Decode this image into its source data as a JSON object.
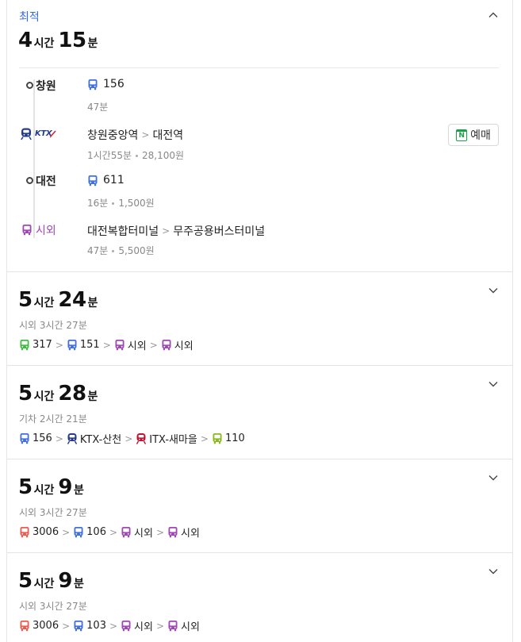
{
  "colors": {
    "accent": "#3569e8",
    "bus_blue": "#3f6fe0",
    "intercity_purple": "#a146b6",
    "bus_green": "#3ebc3e",
    "bus_red": "#ef5a4c",
    "bus_lime": "#8ab91b",
    "itx_red": "#c7102e",
    "ktx_navy": "#243b8c"
  },
  "best_route": {
    "label": "최적",
    "duration": {
      "hours": "4",
      "hour_unit": "시간",
      "minutes": "15",
      "minute_unit": "분"
    },
    "legs": [
      {
        "stop": "창원",
        "stop_icon": "circle-dot-icon",
        "mode_icon": "bus-icon",
        "line": "156",
        "detail": "47분"
      },
      {
        "stop": "KTX",
        "stop_icon": "ktx-logo-icon",
        "from": "창원중앙역",
        "to": "대전역",
        "duration": "1시간55분",
        "fare": "28,100원",
        "book_label": "예매",
        "book_icon": "naver-calendar-icon",
        "book_icon_letter": "N"
      },
      {
        "stop": "대전",
        "stop_icon": "circle-dot-icon",
        "mode_icon": "bus-icon",
        "line": "611",
        "duration": "16분",
        "fare": "1,500원"
      },
      {
        "stop": "시외",
        "stop_icon": "intercity-bus-icon",
        "from": "대전복합터미널",
        "to": "무주공용버스터미널",
        "duration": "47분",
        "fare": "5,500원"
      }
    ]
  },
  "alt_routes": [
    {
      "duration": {
        "hours": "5",
        "hour_unit": "시간",
        "minutes": "24",
        "minute_unit": "분"
      },
      "summary": "시외 3시간 27분",
      "steps": [
        {
          "icon": "green-bus-icon",
          "label": "317"
        },
        {
          "icon": "bus-icon",
          "label": "151"
        },
        {
          "icon": "intercity-bus-icon",
          "label": "시외"
        },
        {
          "icon": "intercity-bus-icon",
          "label": "시외"
        }
      ]
    },
    {
      "duration": {
        "hours": "5",
        "hour_unit": "시간",
        "minutes": "28",
        "minute_unit": "분"
      },
      "summary": "기차 2시간 21분",
      "steps": [
        {
          "icon": "bus-icon",
          "label": "156"
        },
        {
          "icon": "ktx-train-icon",
          "label": "KTX-산천"
        },
        {
          "icon": "itx-train-icon",
          "label": "ITX-새마을"
        },
        {
          "icon": "lime-bus-icon",
          "label": "110"
        }
      ]
    },
    {
      "duration": {
        "hours": "5",
        "hour_unit": "시간",
        "minutes": "9",
        "minute_unit": "분"
      },
      "summary": "시외 3시간 27분",
      "steps": [
        {
          "icon": "red-bus-icon",
          "label": "3006"
        },
        {
          "icon": "bus-icon",
          "label": "106"
        },
        {
          "icon": "intercity-bus-icon",
          "label": "시외"
        },
        {
          "icon": "intercity-bus-icon",
          "label": "시외"
        }
      ]
    },
    {
      "duration": {
        "hours": "5",
        "hour_unit": "시간",
        "minutes": "9",
        "minute_unit": "분"
      },
      "summary": "시외 3시간 27분",
      "steps": [
        {
          "icon": "red-bus-icon",
          "label": "3006"
        },
        {
          "icon": "bus-icon",
          "label": "103"
        },
        {
          "icon": "intercity-bus-icon",
          "label": "시외"
        },
        {
          "icon": "intercity-bus-icon",
          "label": "시외"
        }
      ]
    }
  ],
  "ui": {
    "separator_glyph": ">"
  }
}
